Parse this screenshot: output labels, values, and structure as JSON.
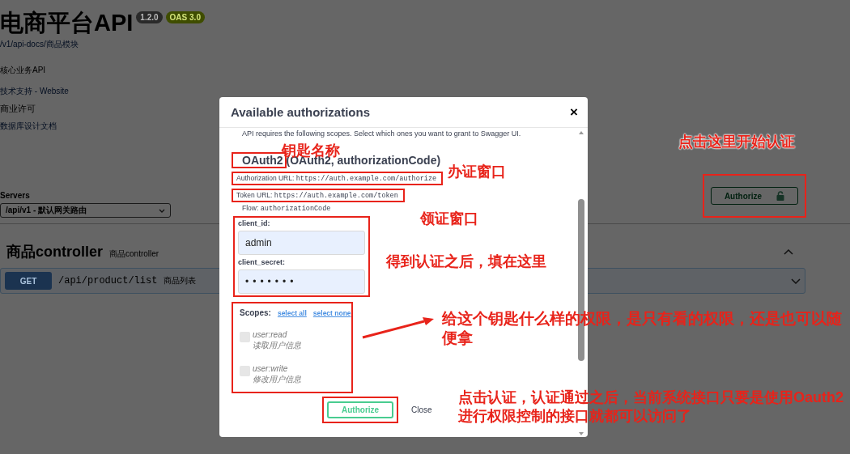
{
  "page": {
    "title": "电商平台API",
    "version": "1.2.0",
    "spec_badge": "OAS 3.0",
    "spec_url": "/v1/api-docs/商品模块",
    "description": "核心业务API",
    "info_lines": [
      {
        "kind": "link",
        "text": "技术支持 - Website"
      },
      {
        "kind": "text",
        "text": "商业许可"
      },
      {
        "kind": "link",
        "text": "数据库设计文档"
      }
    ],
    "servers_label": "Servers",
    "server": "/api/v1 - 默认网关路由",
    "authorize_button": "Authorize",
    "section": {
      "name": "商品controller",
      "description": "商品controller",
      "expanded": true,
      "operations": [
        {
          "method": "GET",
          "path": "/api/product/list",
          "summary": "商品列表"
        }
      ]
    }
  },
  "auth_dialog": {
    "title": "Available authorizations",
    "close": "×",
    "intro": "API requires the following scopes. Select which ones you want to grant to Swagger UI.",
    "scheme_name": "OAuth2",
    "scheme_info": "(OAuth2, authorizationCode)",
    "authorization_url": {
      "label": "Authorization URL:",
      "value": "https://auth.example.com/authorize"
    },
    "token_url": {
      "label": "Token URL:",
      "value": "https://auth.example.com/token"
    },
    "flow": {
      "label": "Flow:",
      "value": "authorizationCode"
    },
    "client_id": {
      "label": "client_id:",
      "value": "admin"
    },
    "client_secret": {
      "label": "client_secret:",
      "value": "•••••••"
    },
    "scopes_label": "Scopes:",
    "select_all": "select all",
    "select_none": "select none",
    "scopes": [
      {
        "name": "user:read",
        "description": "读取用户信息",
        "checked": false
      },
      {
        "name": "user:write",
        "description": "修改用户信息",
        "checked": false
      }
    ],
    "buttons": [
      "Authorize",
      "Close"
    ]
  },
  "annotations": [
    "钥匙名称",
    "办证窗口",
    "领证窗口",
    "得到认证之后，填在这里",
    "给这个钥匙什么样的权限，是只有看的权限，还是也可以随便拿",
    "点击这里开始认证",
    "点击认证，认证通过之后，当前系统接口只要是使用Oauth2进行权限控制的接口就都可以访问了"
  ]
}
